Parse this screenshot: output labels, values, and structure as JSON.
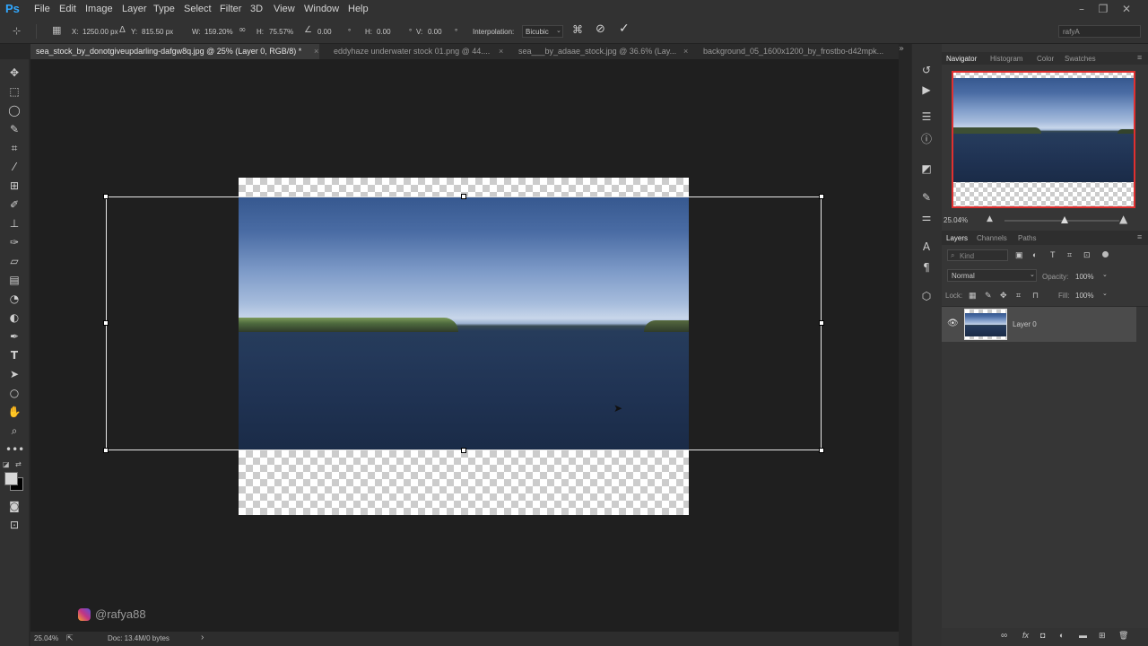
{
  "app": {
    "logo": "Ps"
  },
  "menu": [
    "File",
    "Edit",
    "Image",
    "Layer",
    "Type",
    "Select",
    "Filter",
    "3D",
    "View",
    "Window",
    "Help"
  ],
  "options": {
    "x_label": "X:",
    "x_value": "1250.00 px",
    "y_label": "Y:",
    "y_value": "815.50 px",
    "w_label": "W:",
    "w_value": "159.20%",
    "h_label": "H:",
    "h_value": "75.57%",
    "angle_value": "0.00",
    "angle_unit": "°",
    "hskew_label": "H:",
    "hskew_value": "0.00",
    "hskew_unit": "°",
    "vskew_label": "V:",
    "vskew_value": "0.00",
    "vskew_unit": "°",
    "interp_label": "Interpolation:",
    "interp_value": "Bicubic",
    "workspace": "rafyA"
  },
  "tabs": [
    {
      "label": "sea_stock_by_donotgiveupdarling-dafgw8q.jpg @ 25% (Layer 0, RGB/8) *",
      "active": true
    },
    {
      "label": "eddyhaze underwater stock 01.png @ 44....",
      "active": false
    },
    {
      "label": "sea___by_adaae_stock.jpg @ 36.6% (Lay...",
      "active": false
    },
    {
      "label": "background_05_1600x1200_by_frostbo-d42mpk...",
      "active": false
    }
  ],
  "close_glyph": "×",
  "collapse_glyph": "»",
  "watermark": "@rafya88",
  "status": {
    "zoom": "25.04%",
    "doc": "Doc: 13.4M/0 bytes",
    "arrow": "›"
  },
  "navigator": {
    "tabs": [
      "Navigator",
      "Histogram",
      "Color",
      "Swatches"
    ],
    "zoom": "25.04%",
    "zoom_fraction": 0.52
  },
  "layers": {
    "tabs": [
      "Layers",
      "Channels",
      "Paths"
    ],
    "filter_placeholder": "Kind",
    "blend_mode": "Normal",
    "opacity_label": "Opacity:",
    "opacity_value": "100%",
    "lock_label": "Lock:",
    "fill_label": "Fill:",
    "fill_value": "100%",
    "items": [
      {
        "name": "Layer 0",
        "visible": true
      }
    ]
  },
  "colors": {
    "accent": "#31a8ff",
    "nav_box": "#e03030",
    "selected_layer": "#4b4b4b"
  }
}
